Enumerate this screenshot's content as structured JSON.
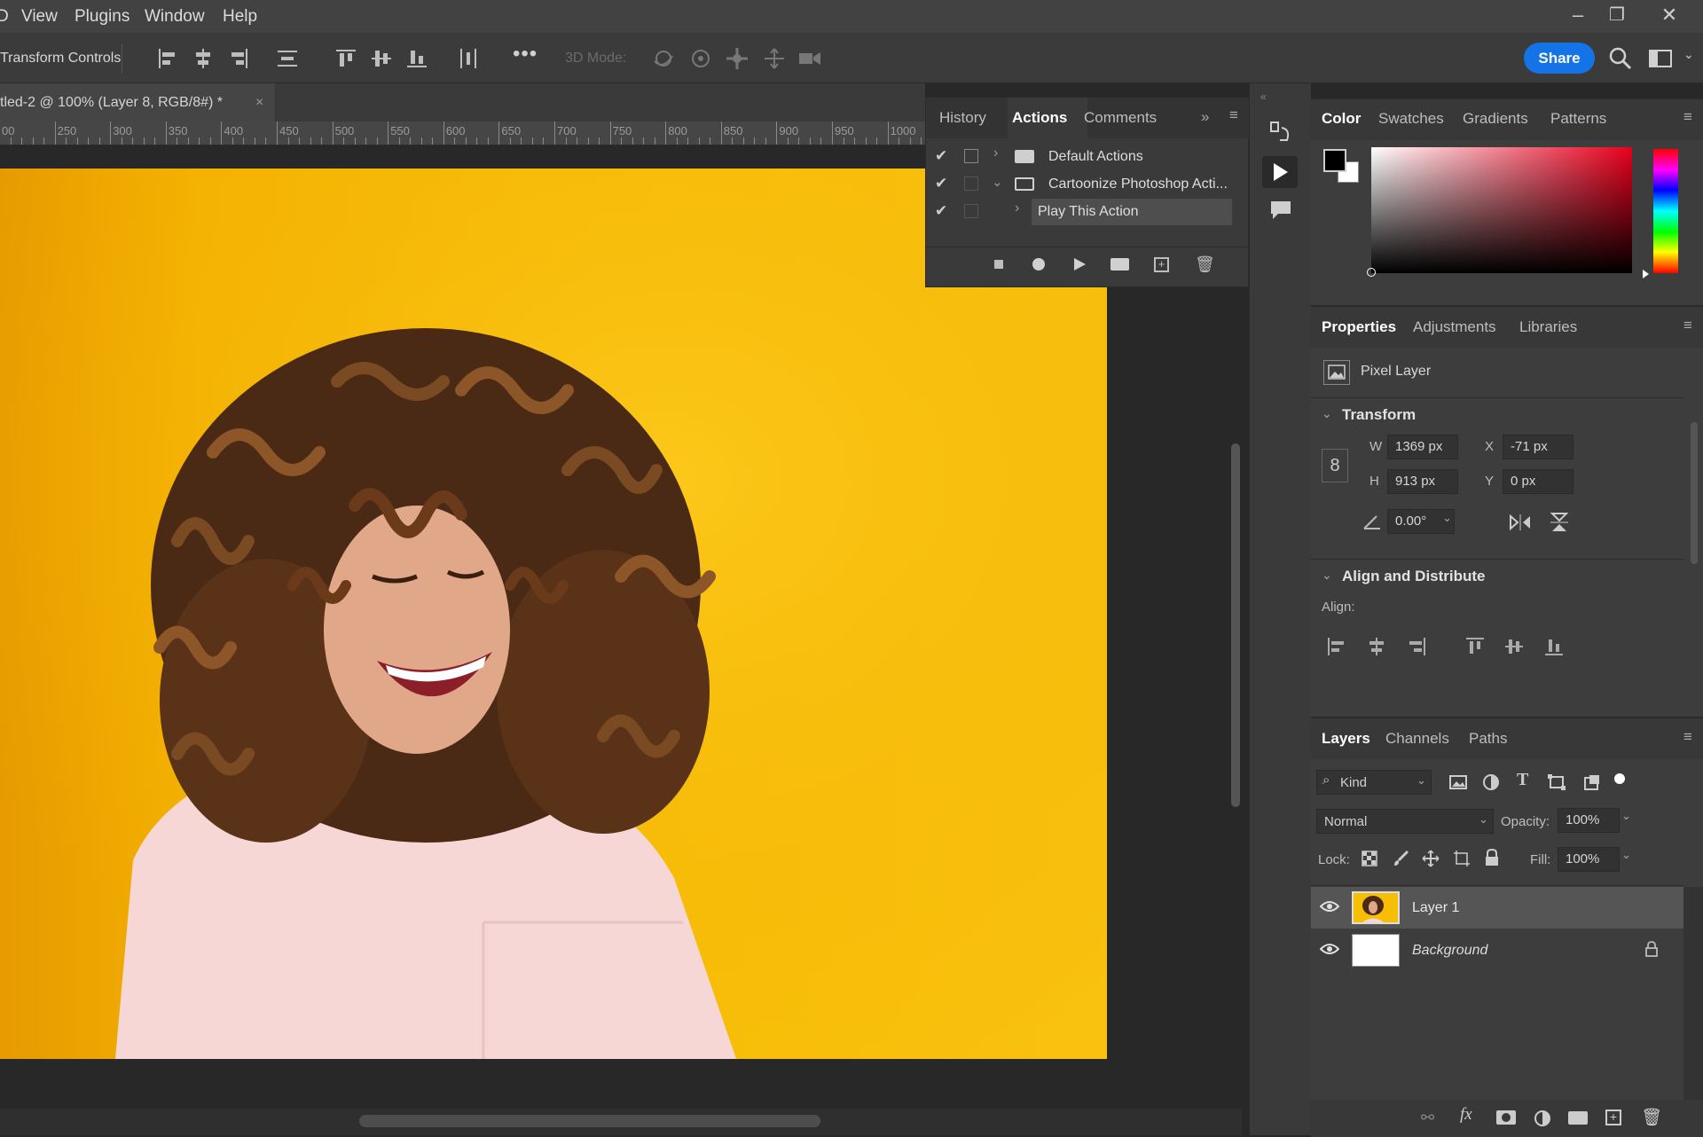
{
  "menu": [
    "View",
    "Plugins",
    "Window",
    "Help"
  ],
  "menu_partial": "D",
  "window_controls": [
    "–",
    "❐",
    "✕"
  ],
  "options": {
    "label": "Transform Controls",
    "mode_3d": "3D Mode:",
    "share": "Share"
  },
  "document": {
    "tab_title": "tled-2 @ 100% (Layer 8, RGB/8#) *",
    "ruler": [
      "00",
      "250",
      "300",
      "350",
      "400",
      "450",
      "500",
      "550",
      "600",
      "650",
      "700",
      "750",
      "800",
      "850",
      "900",
      "950",
      "1000"
    ]
  },
  "actions_panel": {
    "tabs": [
      "History",
      "Actions",
      "Comments"
    ],
    "active_tab": "Actions",
    "rows": [
      {
        "label": "Default Actions",
        "checked": true,
        "expanded": false
      },
      {
        "label": "Cartoonize Photoshop Acti...",
        "checked": true,
        "expanded": true
      },
      {
        "label": "Play This Action",
        "checked": true,
        "expanded": false
      }
    ]
  },
  "color_panel": {
    "tabs": [
      "Color",
      "Swatches",
      "Gradients",
      "Patterns"
    ],
    "active_tab": "Color",
    "foreground": "#000000",
    "background": "#ffffff",
    "hue": "#e8001c"
  },
  "properties_panel": {
    "tabs": [
      "Properties",
      "Adjustments",
      "Libraries"
    ],
    "active_tab": "Properties",
    "layer_type": "Pixel Layer",
    "transform_title": "Transform",
    "w_label": "W",
    "w": "1369 px",
    "h_label": "H",
    "h": "913 px",
    "x_label": "X",
    "x": "-71 px",
    "y_label": "Y",
    "y": "0 px",
    "angle": "0.00°",
    "align_title": "Align and Distribute",
    "align_label": "Align:"
  },
  "layers_panel": {
    "tabs": [
      "Layers",
      "Channels",
      "Paths"
    ],
    "active_tab": "Layers",
    "filter": "Kind",
    "blend_mode": "Normal",
    "opacity_label": "Opacity:",
    "opacity": "100%",
    "lock_label": "Lock:",
    "fill_label": "Fill:",
    "fill": "100%",
    "layers": [
      {
        "name": "Layer 1",
        "selected": true,
        "visible": true
      },
      {
        "name": "Background",
        "selected": false,
        "visible": true,
        "locked": true
      }
    ]
  },
  "colors": {
    "accent": "#1473e6",
    "canvas_bg": "#f7be06"
  }
}
